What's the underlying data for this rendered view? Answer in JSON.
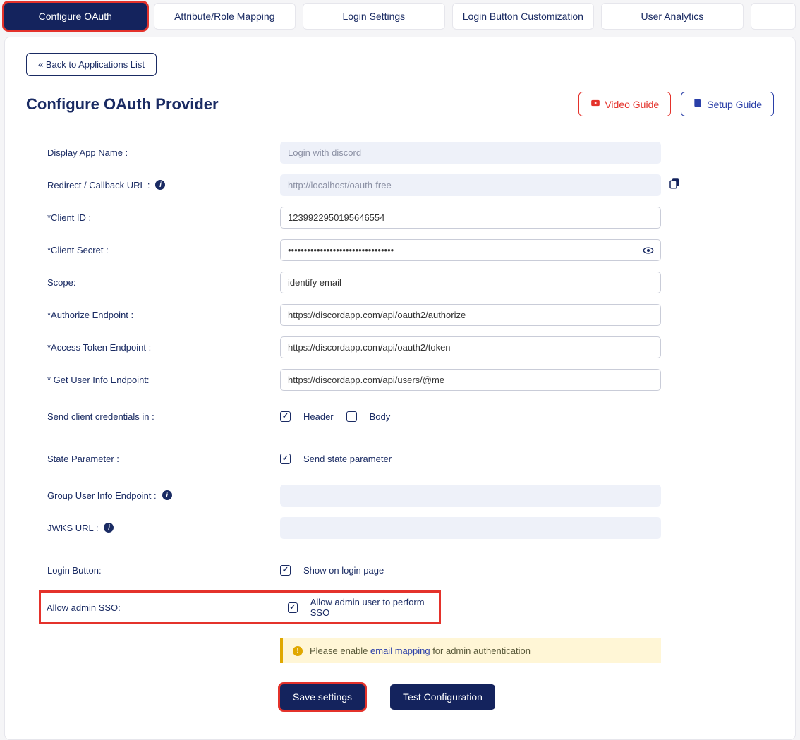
{
  "tabs": {
    "configure_oauth": "Configure OAuth",
    "attr_role_mapping": "Attribute/Role Mapping",
    "login_settings": "Login Settings",
    "login_button_custom": "Login Button Customization",
    "user_analytics": "User Analytics"
  },
  "back_button": "« Back to Applications List",
  "page_title": "Configure OAuth Provider",
  "guides": {
    "video": "Video Guide",
    "setup": "Setup Guide"
  },
  "form": {
    "display_app_name_label": "Display App Name :",
    "display_app_name_value": "Login with discord",
    "redirect_url_label": "Redirect / Callback URL :",
    "redirect_url_value": "http://localhost/oauth-free",
    "client_id_label": "*Client ID :",
    "client_id_value": "1239922950195646554",
    "client_secret_label": "*Client Secret :",
    "client_secret_value": "•••••••••••••••••••••••••••••••••",
    "scope_label": "Scope:",
    "scope_value": "identify email",
    "authorize_ep_label": "*Authorize Endpoint :",
    "authorize_ep_value": "https://discordapp.com/api/oauth2/authorize",
    "token_ep_label": "*Access Token Endpoint :",
    "token_ep_value": "https://discordapp.com/api/oauth2/token",
    "userinfo_ep_label": "* Get User Info Endpoint:",
    "userinfo_ep_value": "https://discordapp.com/api/users/@me",
    "send_creds_label": "Send client credentials in :",
    "send_creds_header": "Header",
    "send_creds_body": "Body",
    "state_param_label": "State Parameter :",
    "state_param_cb": "Send state parameter",
    "group_userinfo_label": "Group User Info Endpoint :",
    "group_userinfo_value": "",
    "jwks_label": "JWKS URL :",
    "jwks_value": "",
    "login_button_label": "Login Button:",
    "login_button_cb": "Show on login page",
    "allow_admin_sso_label": "Allow admin SSO:",
    "allow_admin_sso_cb": "Allow admin user to perform SSO",
    "alert_prefix": "Please enable ",
    "alert_link": "email mapping",
    "alert_suffix": " for admin authentication"
  },
  "actions": {
    "save": "Save settings",
    "test": "Test Configuration"
  }
}
